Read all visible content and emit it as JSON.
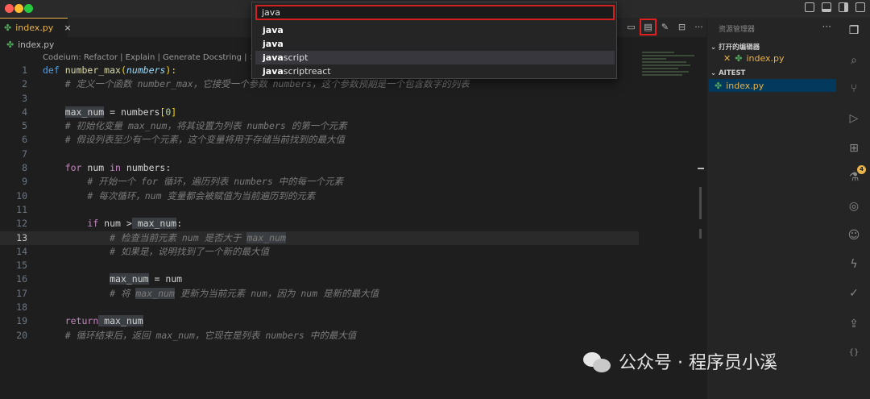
{
  "editor": {
    "tab": {
      "filename": "index.py",
      "close": "×"
    },
    "breadcrumb": "index.py",
    "codelens": "Codeium: Refactor | Explain | Generate Docstring | ×",
    "current_line": 13,
    "lines": [
      {
        "n": "1"
      },
      {
        "n": "2"
      },
      {
        "n": "3"
      },
      {
        "n": "4"
      },
      {
        "n": "5"
      },
      {
        "n": "6"
      },
      {
        "n": "7"
      },
      {
        "n": "8"
      },
      {
        "n": "9"
      },
      {
        "n": "10"
      },
      {
        "n": "11"
      },
      {
        "n": "12"
      },
      {
        "n": "13"
      },
      {
        "n": "14"
      },
      {
        "n": "15"
      },
      {
        "n": "16"
      },
      {
        "n": "17"
      },
      {
        "n": "18"
      },
      {
        "n": "19"
      },
      {
        "n": "20"
      }
    ],
    "code": {
      "l1_def": "def",
      "l1_name": "number_max",
      "l1_open": "(",
      "l1_param": "numbers",
      "l1_close": "):",
      "l2": "# 定义一个函数 number_max，它接受一个参数 numbers，这个参数预期是一个包含数字的列表",
      "l4_var": "max_num",
      "l4_eq": " = ",
      "l4_rhs": "numbers",
      "l4_idx_open": "[",
      "l4_idx": "0",
      "l4_idx_close": "]",
      "l5": "# 初始化变量 max_num，将其设置为列表 numbers 的第一个元素",
      "l6": "# 假设列表至少有一个元素，这个变量将用于存储当前找到的最大值",
      "l8_for": "for",
      "l8_var": " num ",
      "l8_in": "in",
      "l8_seq": " numbers:",
      "l9": "# 开始一个 for 循环，遍历列表 numbers 中的每一个元素",
      "l10": "# 每次循环，num 变量都会被赋值为当前遍历到的元素",
      "l12_if": "if",
      "l12_a": " num ",
      "l12_op": ">",
      "l12_b": " max_num",
      "l12_colon": ":",
      "l13_a": "# 检查当前元素 num 是否大于 ",
      "l13_hl": "max_num",
      "l14": "# 如果是，说明找到了一个新的最大值",
      "l16_var": "max_num",
      "l16_rest": " = num",
      "l17_a": "# 将 ",
      "l17_hl": "max_num",
      "l17_b": " 更新为当前元素 num，因为 num 是新的最大值",
      "l19_ret": "return",
      "l19_var": " max_num",
      "l20": "# 循环结束后，返回 max_num，它现在是列表 numbers 中的最大值"
    }
  },
  "quick_pick": {
    "input_value": "java",
    "items": [
      {
        "match": "java",
        "rest": ""
      },
      {
        "match": "java",
        "rest": ""
      },
      {
        "match": "java",
        "rest": "script"
      },
      {
        "match": "java",
        "rest": "scriptreact"
      }
    ]
  },
  "explorer": {
    "title": "资源管理器",
    "more": "···",
    "open_editors_label": "打开的编辑器",
    "open_file": "index.py",
    "workspace_label": "AITEST",
    "workspace_file": "index.py"
  },
  "activity_bar": {
    "icons": [
      "files-icon",
      "search-icon",
      "source-control-icon",
      "run-debug-icon",
      "extensions-icon",
      "testing-icon",
      "remote-icon",
      "copilot-icon",
      "codeium-icon",
      "check-icon",
      "export-icon",
      "json-icon"
    ],
    "extensions_badge": "4"
  },
  "watermark": {
    "text": "公众号 · 程序员小溪"
  }
}
